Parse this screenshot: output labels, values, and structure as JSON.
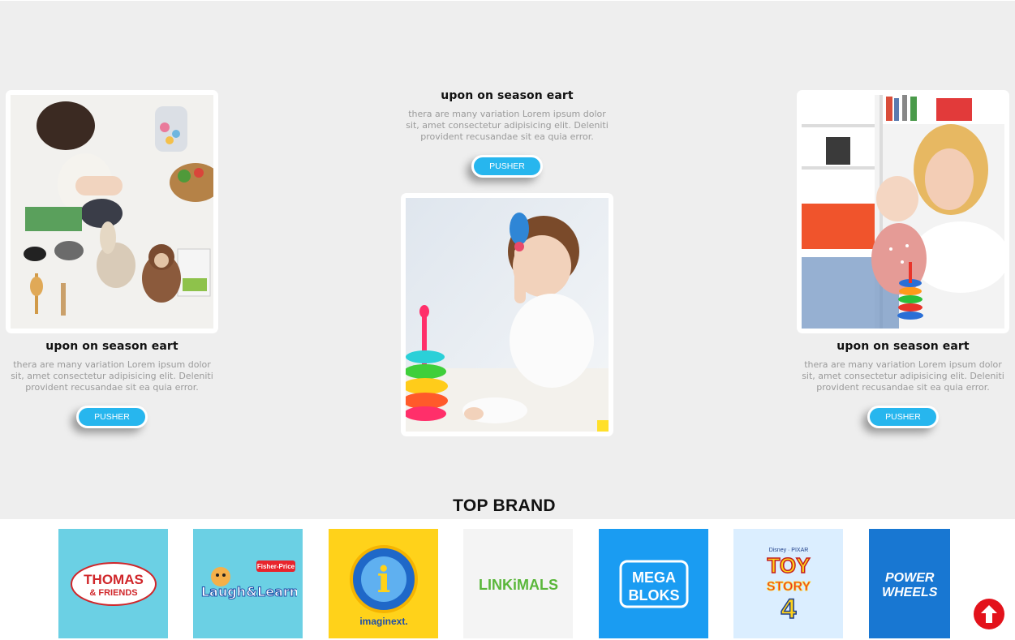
{
  "cards": [
    {
      "title": "upon on season eart",
      "description": "thera are many variation Lorem ipsum dolor sit, amet consectetur adipisicing elit. Deleniti provident recusandae sit ea quia error.",
      "button_label": "PUSHER"
    },
    {
      "title": "upon on season eart",
      "description": "thera are many variation Lorem ipsum dolor sit, amet consectetur adipisicing elit. Deleniti provident recusandae sit ea quia error.",
      "button_label": "PUSHER"
    },
    {
      "title": "upon on season eart",
      "description": "thera are many variation Lorem ipsum dolor sit, amet consectetur adipisicing elit. Deleniti provident recusandae sit ea quia error.",
      "button_label": "PUSHER"
    }
  ],
  "brands_section": {
    "heading": "TOP BRAND",
    "brands": [
      {
        "name": "THOMAS & FRIENDS",
        "line1": "THOMAS",
        "line2": "& FRIENDS",
        "bg": "#6bd0e4"
      },
      {
        "name": "Fisher-Price Laugh&Learn",
        "line1": "Fisher-Price",
        "line2": "Laugh&Learn",
        "bg": "#6bd0e4"
      },
      {
        "name": "imaginext",
        "line1": "i",
        "line2": "imaginext.",
        "bg": "#ffd21a"
      },
      {
        "name": "Linkimals",
        "line1": "LINKiMALS",
        "bg": "#f4f4f4"
      },
      {
        "name": "MEGA BLOKS",
        "line1": "MEGA",
        "line2": "BLOKS",
        "bg": "#1a9cf2"
      },
      {
        "name": "Toy Story 4",
        "line0": "Disney · PIXAR",
        "line1": "TOY",
        "line2": "STORY",
        "line3": "4",
        "bg": "#dbeeff"
      },
      {
        "name": "Power Wheels",
        "line1": "POWER",
        "line2": "WHEELS",
        "bg": "#1877d2"
      }
    ]
  },
  "icons": {
    "scroll_top": "arrow-up-icon"
  },
  "colors": {
    "accent": "#27b6ee",
    "scroll_top": "#e3121b",
    "background": "#eeeeee"
  }
}
